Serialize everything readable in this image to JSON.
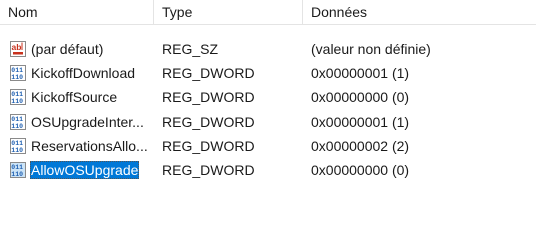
{
  "columns": {
    "name": "Nom",
    "type": "Type",
    "data": "Données"
  },
  "rows": [
    {
      "name": "(par défaut)",
      "type": "REG_SZ",
      "data": "(valeur non définie)",
      "icon": "string-value-icon"
    },
    {
      "name": "KickoffDownload",
      "type": "REG_DWORD",
      "data": "0x00000001 (1)",
      "icon": "binary-value-icon"
    },
    {
      "name": "KickoffSource",
      "type": "REG_DWORD",
      "data": "0x00000000 (0)",
      "icon": "binary-value-icon"
    },
    {
      "name": "OSUpgradeInter...",
      "type": "REG_DWORD",
      "data": "0x00000001 (1)",
      "icon": "binary-value-icon"
    },
    {
      "name": "ReservationsAllo...",
      "type": "REG_DWORD",
      "data": "0x00000002 (2)",
      "icon": "binary-value-icon"
    },
    {
      "name": "AllowOSUpgrade",
      "type": "REG_DWORD",
      "data": "0x00000000 (0)",
      "icon": "binary-value-icon",
      "selected": true
    }
  ],
  "colors": {
    "selection": "#0078d7",
    "string_icon_red": "#c8321e",
    "binary_icon_blue": "#1f5fb0"
  }
}
